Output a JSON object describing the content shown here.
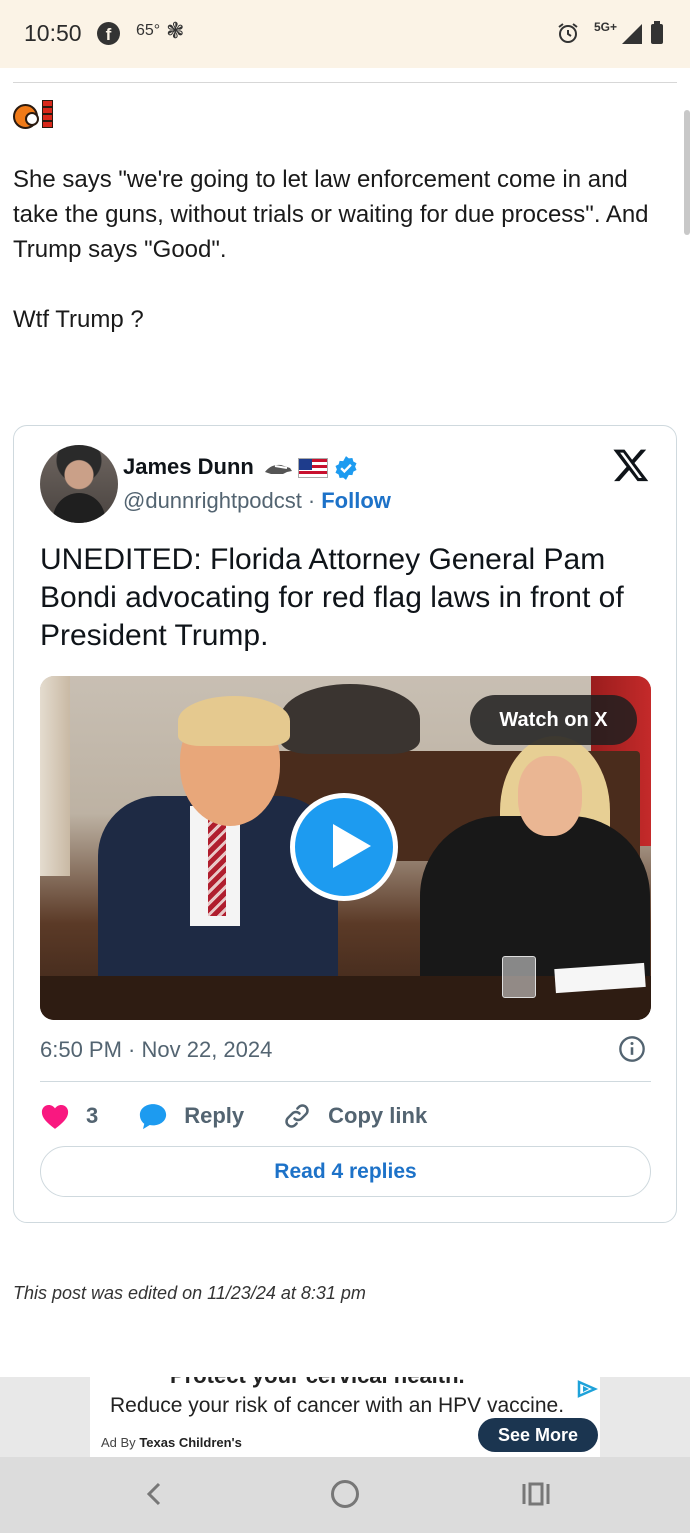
{
  "status_bar": {
    "time": "10:50",
    "facebook_icon": "f",
    "temperature": "65°",
    "fan_icon": "❃",
    "network": "5G+"
  },
  "post": {
    "paragraphs": [
      "She says \"we're going to let law enforcement come in and take the guns, without trials or waiting for due process\". And Trump says \"Good\".",
      "Wtf Trump ?"
    ],
    "edited_note": "This post was edited on 11/23/24 at 8:31 pm"
  },
  "tweet": {
    "author_name": "James Dunn",
    "handle": "@dunnrightpodcst",
    "separator": "·",
    "follow_label": "Follow",
    "text": "UNEDITED: Florida Attorney General Pam Bondi advocating for red flag laws in front of President Trump.",
    "watch_label": "Watch on X",
    "timestamp": "6:50 PM · Nov 22, 2024",
    "likes": "3",
    "reply_label": "Reply",
    "copy_link_label": "Copy link",
    "read_replies_label": "Read 4 replies",
    "colors": {
      "accent": "#1d9bf0",
      "like": "#f91880",
      "text_secondary": "#536471"
    }
  },
  "ad": {
    "headline": "Protect your cervical health.",
    "body": "Reduce your risk of cancer with an HPV vaccine.",
    "ad_by_label": "Ad By",
    "advertiser": "Texas Children's",
    "cta": "See More"
  },
  "nav": {
    "icons": [
      "back-icon",
      "home-icon",
      "recent-apps-icon"
    ]
  }
}
